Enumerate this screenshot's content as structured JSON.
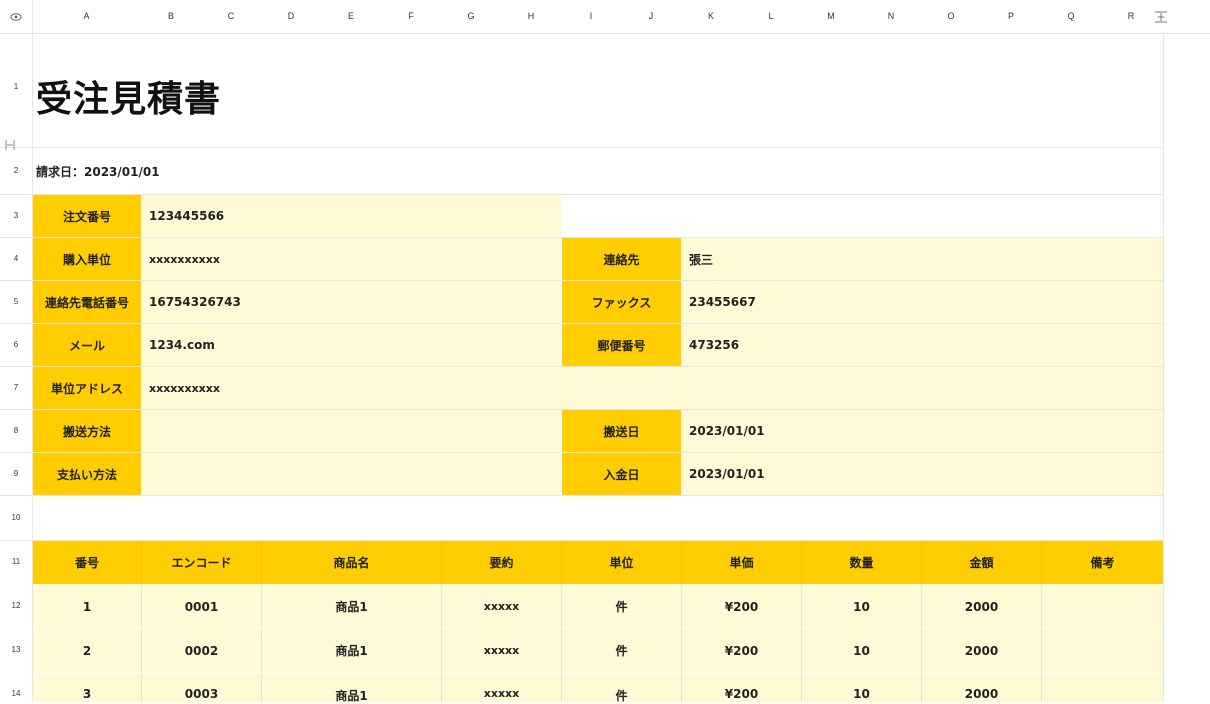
{
  "sheet": {
    "columns": [
      "A",
      "B",
      "C",
      "D",
      "E",
      "F",
      "G",
      "H",
      "I",
      "J",
      "K",
      "L",
      "M",
      "N",
      "O",
      "P",
      "Q",
      "R"
    ],
    "rows": [
      "1",
      "2",
      "3",
      "4",
      "5",
      "6",
      "7",
      "8",
      "9",
      "10",
      "11",
      "12",
      "13",
      "14"
    ]
  },
  "title": "受注見積書",
  "request_date": "請求日：2023/01/01",
  "info": {
    "order_no_label": "注文番号",
    "order_no": "123445566",
    "purchase_unit_label": "購入単位",
    "purchase_unit": "xxxxxxxxxx",
    "contact_label": "連絡先",
    "contact": "張三",
    "phone_label": "連絡先電話番号",
    "phone": "16754326743",
    "fax_label": "ファックス",
    "fax": "23455667",
    "mail_label": "メール",
    "mail": "1234.com",
    "zip_label": "郵便番号",
    "zip": "473256",
    "address_label": "単位アドレス",
    "address": "xxxxxxxxxx",
    "ship_method_label": "搬送方法",
    "ship_method": "",
    "ship_date_label": "搬送日",
    "ship_date": "2023/01/01",
    "pay_method_label": "支払い方法",
    "pay_method": "",
    "pay_date_label": "入金日",
    "pay_date": "2023/01/01"
  },
  "table": {
    "headers": [
      "番号",
      "エンコード",
      "商品名",
      "要約",
      "単位",
      "単価",
      "数量",
      "金額",
      "備考"
    ],
    "rows": [
      [
        "1",
        "0001",
        "商品1",
        "xxxxx",
        "件",
        "¥200",
        "10",
        "2000",
        ""
      ],
      [
        "2",
        "0002",
        "商品1",
        "xxxxx",
        "件",
        "¥200",
        "10",
        "2000",
        ""
      ],
      [
        "3",
        "0003",
        "商品1",
        "xxxxx",
        "件",
        "¥200",
        "10",
        "2000",
        ""
      ]
    ]
  }
}
